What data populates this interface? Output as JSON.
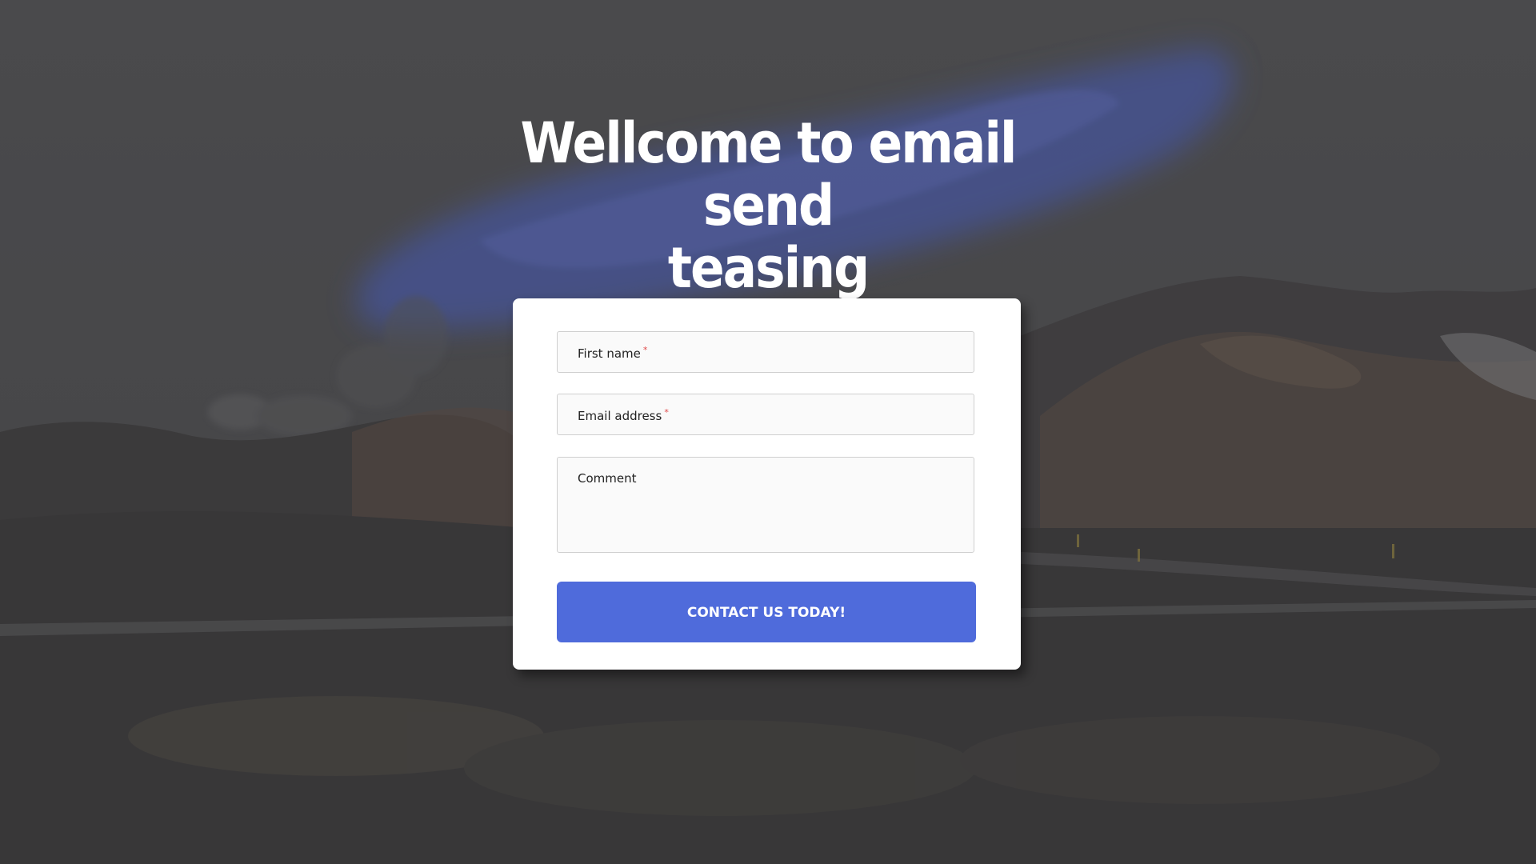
{
  "hero": {
    "title_line1": "Wellcome to email send",
    "title_line2": "teasing"
  },
  "form": {
    "first_name_label": "First name",
    "email_label": "Email address",
    "comment_label": "Comment",
    "required_marker": "*",
    "submit_label": "CONTACT US TODAY!"
  },
  "colors": {
    "accent": "#4f6bdb",
    "brush": "#4a5fc7",
    "required": "#e04a4a",
    "overlay": "#3f3f41"
  }
}
